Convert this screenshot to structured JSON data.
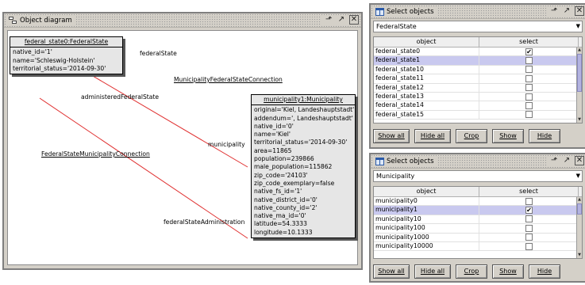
{
  "diagram": {
    "title": "Object diagram",
    "objects": [
      {
        "header": "federal_state0:FederalState",
        "attributes": [
          "native_id='1'",
          "name='Schleswig-Holstein'",
          "territorial_status='2014-09-30'"
        ]
      },
      {
        "header": "municipality1:Municipality",
        "attributes": [
          "original='Kiel, Landeshauptstadt'",
          "addendum=', Landeshauptstadt'",
          "native_id='0'",
          "name='Kiel'",
          "territorial_status='2014-09-30'",
          "area=11865",
          "population=239866",
          "male_population=115862",
          "zip_code='24103'",
          "zip_code_exemplary=false",
          "native_fs_id='1'",
          "native_district_id='0'",
          "native_county_id='2'",
          "native_ma_id='0'",
          "latitude=54.3333",
          "longitude=10.1333"
        ]
      }
    ],
    "links": {
      "role_federal_state": "federalState",
      "assoc_1": "MunicipalityFederalStateConnection",
      "role_administered": "administeredFederalState",
      "role_municipality": "municipality",
      "assoc_2": "FederalStateMunicipalityConnection",
      "role_federal_state_administration": "federalStateAdministration"
    },
    "link_color": "#e03030"
  },
  "select_windows": [
    {
      "title": "Select objects",
      "dropdown_value": "FederalState",
      "col_object": "object",
      "col_select": "select",
      "rows": [
        {
          "name": "federal_state0",
          "checked": true,
          "highlighted": false
        },
        {
          "name": "federal_state1",
          "checked": false,
          "highlighted": true
        },
        {
          "name": "federal_state10",
          "checked": false,
          "highlighted": false
        },
        {
          "name": "federal_state11",
          "checked": false,
          "highlighted": false
        },
        {
          "name": "federal_state12",
          "checked": false,
          "highlighted": false
        },
        {
          "name": "federal_state13",
          "checked": false,
          "highlighted": false
        },
        {
          "name": "federal_state14",
          "checked": false,
          "highlighted": false
        },
        {
          "name": "federal_state15",
          "checked": false,
          "highlighted": false
        }
      ],
      "buttons": {
        "show_all": "Show all",
        "hide_all": "Hide all",
        "crop": "Crop",
        "show": "Show",
        "hide": "Hide"
      }
    },
    {
      "title": "Select objects",
      "dropdown_value": "Municipality",
      "col_object": "object",
      "col_select": "select",
      "rows": [
        {
          "name": "municipality0",
          "checked": false,
          "highlighted": false
        },
        {
          "name": "municipality1",
          "checked": true,
          "highlighted": true
        },
        {
          "name": "municipality10",
          "checked": false,
          "highlighted": false
        },
        {
          "name": "municipality100",
          "checked": false,
          "highlighted": false
        },
        {
          "name": "municipality1000",
          "checked": false,
          "highlighted": false
        },
        {
          "name": "municipality10000",
          "checked": false,
          "highlighted": false
        }
      ],
      "buttons": {
        "show_all": "Show all",
        "hide_all": "Hide all",
        "crop": "Crop",
        "show": "Show",
        "hide": "Hide"
      }
    }
  ],
  "icons": {
    "undock": "undock-icon",
    "maximize": "maximize-icon",
    "close": "close-icon",
    "check": "✔",
    "dropdown_arrow": "▼"
  }
}
